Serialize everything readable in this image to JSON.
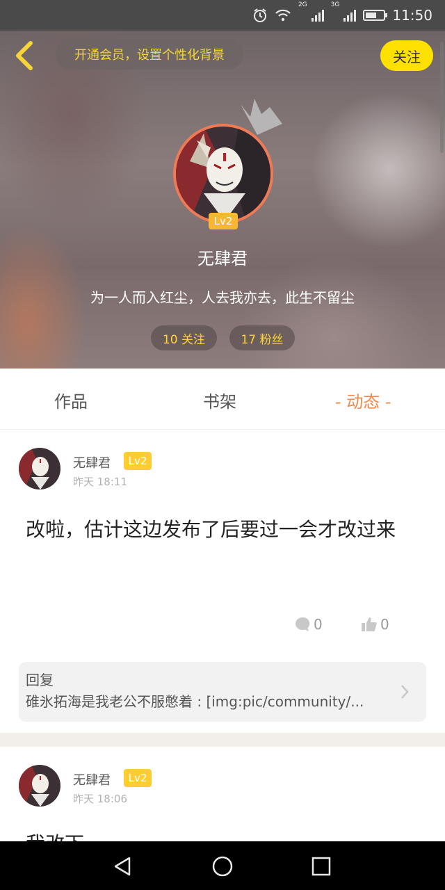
{
  "status_bar": {
    "time": "11:50",
    "net1": "2G",
    "net2": "3G",
    "battery_level": 0.6,
    "icons": [
      "alarm-icon",
      "wifi-icon",
      "signal-icon",
      "signal-icon",
      "battery-icon"
    ]
  },
  "header": {
    "vip_text": "开通会员，设置个性化背景",
    "follow_label": "关注",
    "level": "Lv2",
    "username": "无肆君",
    "bio": "为一人而入红尘，人去我亦去，此生不留尘",
    "following": "10 关注",
    "followers": "17 粉丝"
  },
  "tabs": [
    {
      "label": "作品",
      "active": false
    },
    {
      "label": "书架",
      "active": false
    },
    {
      "label": "- 动态 -",
      "active": true
    }
  ],
  "posts": [
    {
      "author": "无肆君",
      "level": "Lv2",
      "time": "昨天 18:11",
      "text": "改啦，估计这边发布了后要过一会才改过来",
      "comments": "0",
      "likes": "0",
      "reply": {
        "title": "回复",
        "text": "碓氷拓海是我老公不服憋着 : [img:pic/community/..."
      }
    },
    {
      "author": "无肆君",
      "level": "Lv2",
      "time": "昨天 18:06",
      "text": "我改下"
    }
  ],
  "colors": {
    "accent_yellow": "#ffe100",
    "accent_orange": "#f08a4b",
    "level_badge": "#f7b733"
  }
}
